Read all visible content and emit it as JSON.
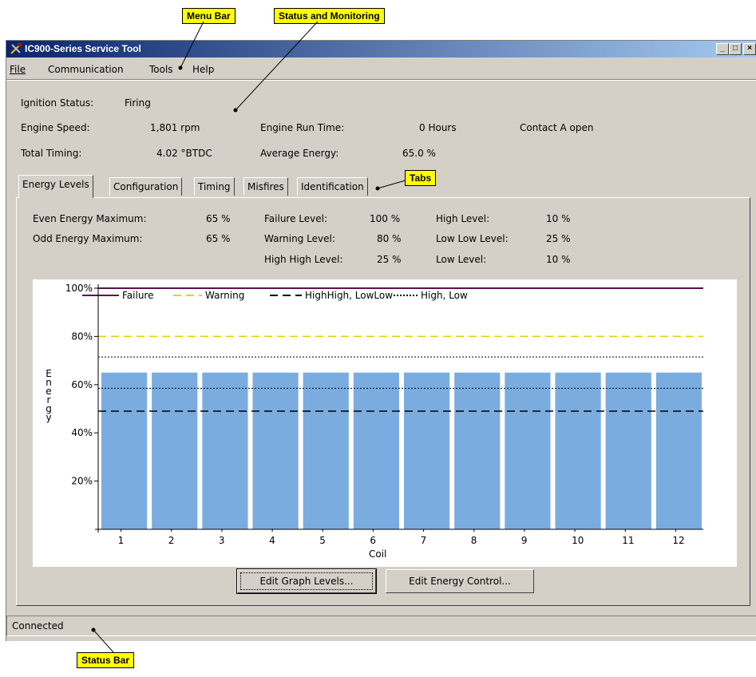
{
  "callouts": {
    "menu_bar": "Menu Bar",
    "status_monitoring": "Status and Monitoring",
    "tabs": "Tabs",
    "status_bar": "Status Bar"
  },
  "window": {
    "title": "IC900-Series Service Tool",
    "buttons": {
      "minimize": "_",
      "maximize": "□",
      "close": "×"
    }
  },
  "menu": [
    "File",
    "Communication",
    "Tools",
    "Help"
  ],
  "status": {
    "ignition_label": "Ignition Status:",
    "ignition_value": "Firing",
    "speed_label": "Engine Speed:",
    "speed_value": "1,801 rpm",
    "runtime_label": "Engine Run Time:",
    "runtime_value": "0 Hours",
    "contact": "Contact A open",
    "timing_label": "Total Timing:",
    "timing_value": "4.02 °BTDC",
    "energy_label": "Average Energy:",
    "energy_value": "65.0 %"
  },
  "tabs": [
    "Energy Levels",
    "Configuration",
    "Timing",
    "Misfires",
    "Identification"
  ],
  "active_tab": 0,
  "levels": {
    "even_label": "Even Energy Maximum:",
    "even_value": "65 %",
    "odd_label": "Odd Energy Maximum:",
    "odd_value": "65 %",
    "failure_label": "Failure Level:",
    "failure_value": "100 %",
    "warning_label": "Warning Level:",
    "warning_value": "80 %",
    "highhigh_label": "High High Level:",
    "highhigh_value": "25 %",
    "high_label": "High Level:",
    "high_value": "10 %",
    "lowlow_label": "Low Low Level:",
    "lowlow_value": "25 %",
    "low_label": "Low Level:",
    "low_value": "10 %"
  },
  "chart_data": {
    "type": "bar",
    "categories": [
      "1",
      "2",
      "3",
      "4",
      "5",
      "6",
      "7",
      "8",
      "9",
      "10",
      "11",
      "12"
    ],
    "values": [
      65,
      65,
      65,
      65,
      65,
      65,
      65,
      65,
      65,
      65,
      65,
      65
    ],
    "xlabel": "Coil",
    "ylabel": "Energy",
    "ylim": [
      0,
      100
    ],
    "y_ticks": [
      "20%",
      "40%",
      "60%",
      "80%",
      "100%"
    ],
    "y_tick_values": [
      20,
      40,
      60,
      80,
      100
    ],
    "bar_color": "#7aace0",
    "reference_lines": [
      {
        "name": "Failure",
        "value": 100,
        "style": "solid",
        "color": "#5c0f4e"
      },
      {
        "name": "Warning",
        "value": 80,
        "style": "dashed",
        "color": "#e0d000"
      },
      {
        "name": "HighHigh, LowLow",
        "value": 49,
        "style": "dashed",
        "color": "#000000"
      },
      {
        "name": "High, Low",
        "value": 71.5,
        "style": "dotted",
        "color": "#000000"
      },
      {
        "name": "High, Low",
        "value": 58.5,
        "style": "dotted",
        "color": "#000000"
      }
    ],
    "legend": [
      {
        "label": "Failure",
        "style": "solid",
        "color": "#5c0f4e"
      },
      {
        "label": "Warning",
        "style": "dashed",
        "color": "#e0d000"
      },
      {
        "label": "HighHigh, LowLow",
        "style": "dashed",
        "color": "#000000"
      },
      {
        "label": "High, Low",
        "style": "dotted",
        "color": "#000000"
      }
    ],
    "legend_position": "top"
  },
  "buttons": {
    "edit_graph": "Edit Graph Levels...",
    "edit_energy": "Edit Energy Control..."
  },
  "statusbar": {
    "text": "Connected"
  }
}
